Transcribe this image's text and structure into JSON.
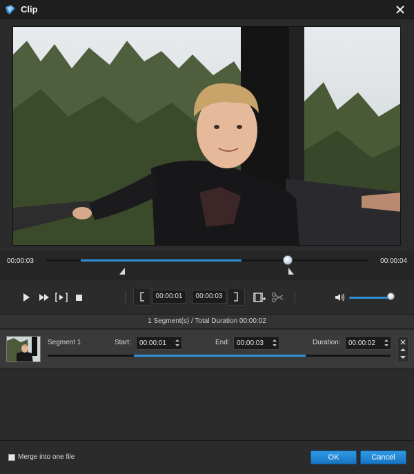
{
  "window": {
    "title": "Clip",
    "accent_color": "#2f8fd8",
    "background_color": "#2b2b2b"
  },
  "timeline": {
    "current_time": "00:00:03",
    "total_time": "00:00:04",
    "playhead_fraction": 0.75,
    "selection_start_fraction": 0.25,
    "selection_end_fraction": 0.75
  },
  "controls": {
    "start_time": "00:00:01",
    "end_time": "00:00:03",
    "volume_fraction": 0.92,
    "icons": [
      "play-icon",
      "fast-forward-icon",
      "frame-step-icon",
      "stop-icon",
      "set-start-icon",
      "set-end-icon",
      "add-clip-icon",
      "cut-icon",
      "volume-icon"
    ]
  },
  "summary": {
    "text": "1 Segment(s) / Total Duration 00:00:02"
  },
  "segment": {
    "name": "Segment 1",
    "start_label": "Start:",
    "start_value": "00:00:01",
    "end_label": "End:",
    "end_value": "00:00:03",
    "duration_label": "Duration:",
    "duration_value": "00:00:02"
  },
  "footer": {
    "merge_label": "Merge into one file",
    "merge_checked": false,
    "ok_label": "OK",
    "cancel_label": "Cancel"
  }
}
